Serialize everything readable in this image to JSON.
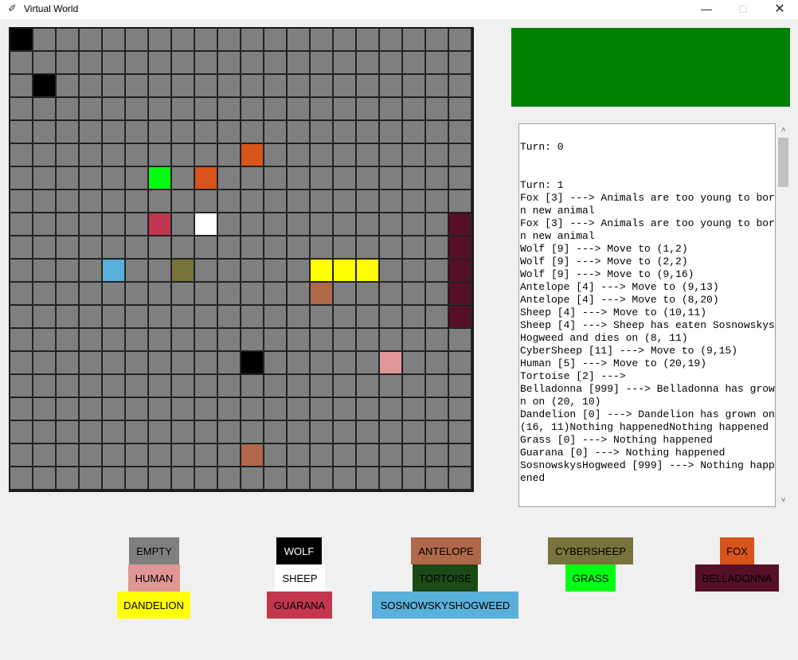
{
  "window": {
    "title": "Virtual World"
  },
  "board": {
    "rows": 20,
    "cols": 20,
    "empty_color": "#7f7f7f",
    "organisms": [
      {
        "row": 0,
        "col": 0,
        "type": "WOLF"
      },
      {
        "row": 2,
        "col": 1,
        "type": "WOLF"
      },
      {
        "row": 5,
        "col": 10,
        "type": "FOX"
      },
      {
        "row": 6,
        "col": 6,
        "type": "GRASS"
      },
      {
        "row": 6,
        "col": 8,
        "type": "FOX"
      },
      {
        "row": 8,
        "col": 6,
        "type": "GUARANA"
      },
      {
        "row": 8,
        "col": 8,
        "type": "SHEEP"
      },
      {
        "row": 8,
        "col": 19,
        "type": "BELLADONNA"
      },
      {
        "row": 9,
        "col": 19,
        "type": "BELLADONNA"
      },
      {
        "row": 10,
        "col": 4,
        "type": "SOSNOWSKYSHOGWEED"
      },
      {
        "row": 10,
        "col": 7,
        "type": "CYBERSHEEP"
      },
      {
        "row": 10,
        "col": 13,
        "type": "DANDELION"
      },
      {
        "row": 10,
        "col": 14,
        "type": "DANDELION"
      },
      {
        "row": 10,
        "col": 15,
        "type": "DANDELION"
      },
      {
        "row": 10,
        "col": 19,
        "type": "BELLADONNA"
      },
      {
        "row": 11,
        "col": 13,
        "type": "ANTELOPE"
      },
      {
        "row": 11,
        "col": 19,
        "type": "BELLADONNA"
      },
      {
        "row": 12,
        "col": 19,
        "type": "BELLADONNA"
      },
      {
        "row": 14,
        "col": 10,
        "type": "WOLF"
      },
      {
        "row": 14,
        "col": 16,
        "type": "HUMAN"
      },
      {
        "row": 18,
        "col": 10,
        "type": "ANTELOPE"
      }
    ]
  },
  "status_panel": {
    "color": "#008000"
  },
  "log": {
    "text": "\nTurn: 0\n\n\nTurn: 1\nFox [3] ---> Animals are too young to born new animal\nFox [3] ---> Animals are too young to born new animal\nWolf [9] ---> Move to (1,2)\nWolf [9] ---> Move to (2,2)\nWolf [9] ---> Move to (9,16)\nAntelope [4] ---> Move to (9,13)\nAntelope [4] ---> Move to (8,20)\nSheep [4] ---> Move to (10,11)\nSheep [4] ---> Sheep has eaten SosnowskysHogweed and dies on (8, 11)\nCyberSheep [11] ---> Move to (9,15)\nHuman [5] ---> Move to (20,19)\nTortoise [2] --->\nBelladonna [999] ---> Belladonna has grown on (20, 10)\nDandelion [0] ---> Dandelion has grown on (16, 11)Nothing happenedNothing happened\nGrass [0] ---> Nothing happened\nGuarana [0] ---> Nothing happened\nSosnowskysHogweed [999] ---> Nothing happened"
  },
  "legend": [
    {
      "key": "EMPTY",
      "label": "EMPTY",
      "bg": "#7f7f7f",
      "fg": "#000000"
    },
    {
      "key": "WOLF",
      "label": "WOLF",
      "bg": "#000000",
      "fg": "#ffffff"
    },
    {
      "key": "ANTELOPE",
      "label": "ANTELOPE",
      "bg": "#b0684a",
      "fg": "#000000"
    },
    {
      "key": "CYBERSHEEP",
      "label": "CYBERSHEEP",
      "bg": "#76743a",
      "fg": "#000000"
    },
    {
      "key": "FOX",
      "label": "FOX",
      "bg": "#d9541a",
      "fg": "#000000"
    },
    {
      "key": "HUMAN",
      "label": "HUMAN",
      "bg": "#e19696",
      "fg": "#000000"
    },
    {
      "key": "SHEEP",
      "label": "SHEEP",
      "bg": "#ffffff",
      "fg": "#000000"
    },
    {
      "key": "TORTOISE",
      "label": "TORTOISE",
      "bg": "#1b4a17",
      "fg": "#000000"
    },
    {
      "key": "GRASS",
      "label": "GRASS",
      "bg": "#00ff12",
      "fg": "#000000"
    },
    {
      "key": "BELLADONNA",
      "label": "BELLADONNA",
      "bg": "#550f28",
      "fg": "#000000"
    },
    {
      "key": "DANDELION",
      "label": "DANDELION",
      "bg": "#ffff00",
      "fg": "#000000"
    },
    {
      "key": "GUARANA",
      "label": "GUARANA",
      "bg": "#c0374f",
      "fg": "#000000"
    },
    {
      "key": "SOSNOWSKYSHOGWEED",
      "label": "SOSNOWSKYSHOGWEED",
      "bg": "#5aafdb",
      "fg": "#000000"
    }
  ]
}
